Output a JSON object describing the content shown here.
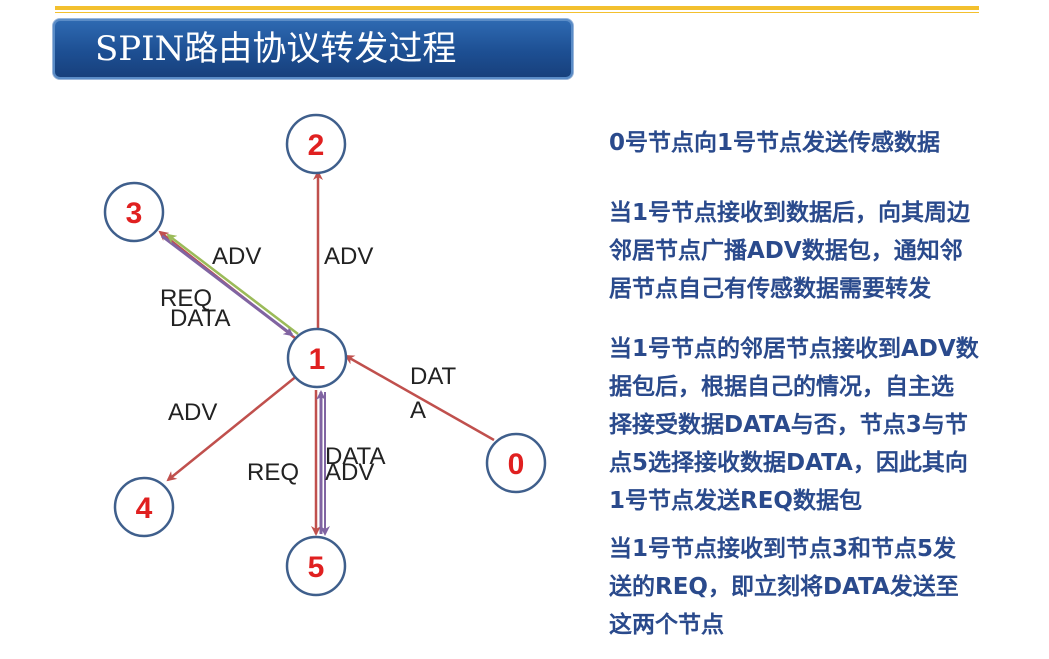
{
  "title": "SPIN路由协议转发过程",
  "nodes": [
    {
      "id": "n0",
      "label": "0"
    },
    {
      "id": "n1",
      "label": "1"
    },
    {
      "id": "n2",
      "label": "2"
    },
    {
      "id": "n3",
      "label": "3"
    },
    {
      "id": "n4",
      "label": "4"
    },
    {
      "id": "n5",
      "label": "5"
    }
  ],
  "edge_labels": {
    "adv_3": "ADV",
    "adv_2": "ADV",
    "req_3": "REQ",
    "data_3": "DATA",
    "data_0_a": "DAT",
    "data_0_b": "A",
    "adv_4": "ADV",
    "data_5": "DATA",
    "req_5": "REQ",
    "adv_5": "ADV"
  },
  "colors": {
    "adv_arrow": "#c0504d",
    "req_arrow": "#8064a2",
    "data_arrow": "#9bbb59",
    "text_blue": "#2a4a8c",
    "node_label": "#e02020"
  },
  "description": [
    [
      "0号节点向1号节点发送传感数据"
    ],
    [
      "当1号节点接收到数据后，向其周边",
      "邻居节点广播ADV数据包，通知邻",
      "居节点自己有传感数据需要转发"
    ],
    [
      "当1号节点的邻居节点接收到ADV数",
      "据包后，根据自己的情况，自主选",
      "择接受数据DATA与否，节点3与节",
      "点5选择接收数据DATA，因此其向",
      "1号节点发送REQ数据包"
    ],
    [
      "当1号节点接收到节点3和节点5发",
      "送的REQ，即立刻将DATA发送至",
      "这两个节点"
    ]
  ]
}
